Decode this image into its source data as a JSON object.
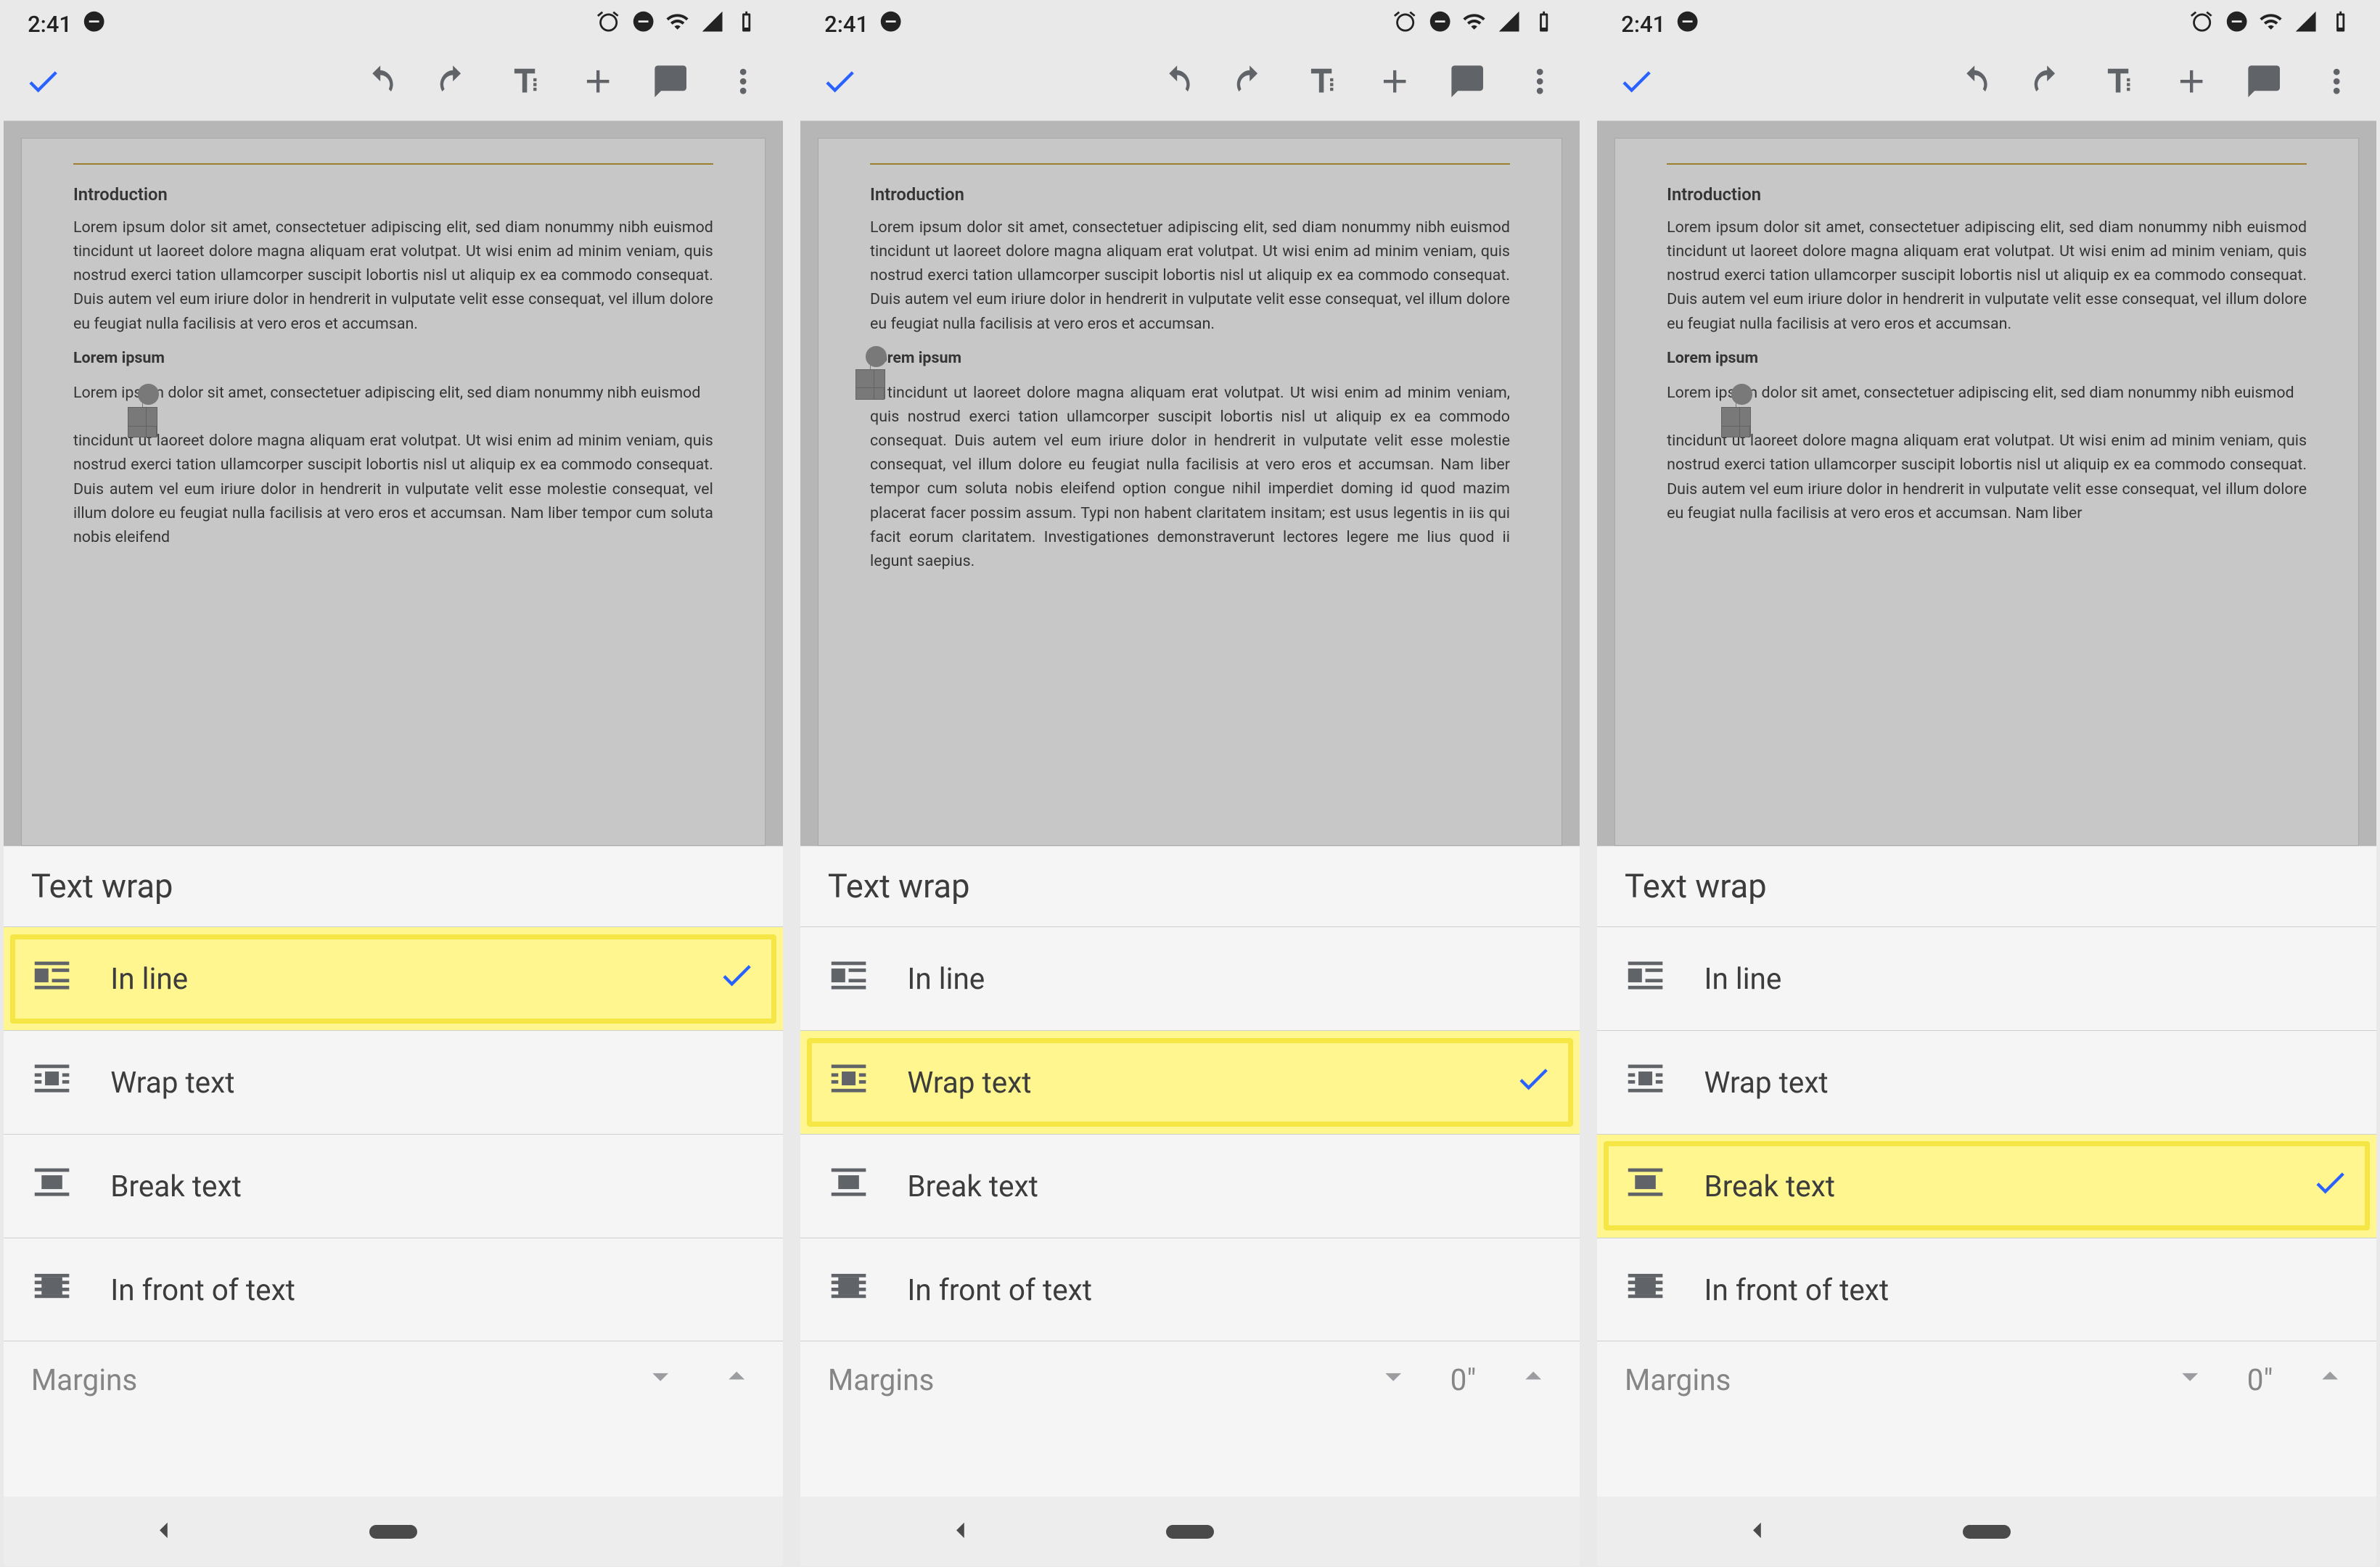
{
  "status": {
    "time": "2:41"
  },
  "toolbar": {
    "done": "Done",
    "undo": "Undo",
    "redo": "Redo",
    "format": "Text format",
    "insert": "Insert",
    "comment": "Comment",
    "more": "More"
  },
  "doc": {
    "heading": "Introduction",
    "para1": "Lorem ipsum dolor sit amet, consectetuer adipiscing elit, sed diam nonummy nibh euismod tincidunt ut laoreet dolore magna aliquam erat volutpat. Ut wisi enim ad minim veniam, quis nostrud exerci tation ullamcorper suscipit lobortis nisl ut aliquip ex ea commodo consequat. Duis autem vel eum iriure dolor in hendrerit in vulputate velit esse consequat, vel illum dolore eu feugiat nulla facilisis at vero eros et accumsan.",
    "subhead": "Lorem ipsum",
    "para2": "Lorem ipsum dolor sit amet, consectetuer adipiscing elit, sed diam nonummy nibh euismod",
    "para3": "tincidunt ut laoreet dolore magna aliquam erat volutpat. Ut wisi enim ad minim veniam, quis nostrud exerci tation ullamcorper suscipit lobortis nisl ut aliquip ex ea commodo consequat. Duis autem vel eum iriure dolor in hendrerit in vulputate velit esse molestie consequat, vel illum dolore eu feugiat nulla facilisis at vero eros et accumsan. Nam liber tempor cum soluta nobis eleifend",
    "wrapPara": "tincidunt ut laoreet dolore magna aliquam erat volutpat. Ut wisi enim ad minim veniam, quis nostrud exerci tation ullamcorper suscipit lobortis nisl ut aliquip ex ea commodo consequat. Duis autem vel eum iriure dolor in hendrerit in vulputate velit esse molestie consequat, vel illum dolore eu feugiat nulla facilisis at vero eros et accumsan. Nam liber tempor cum soluta nobis eleifend option congue nihil imperdiet doming id quod mazim placerat facer possim assum. Typi non habent claritatem insitam; est usus legentis in iis qui facit eorum claritatem. Investigationes demonstraverunt lectores legere me lius quod ii legunt saepius.",
    "breakPara": "tincidunt ut laoreet dolore magna aliquam erat volutpat. Ut wisi enim ad minim veniam, quis nostrud exerci tation ullamcorper suscipit lobortis nisl ut aliquip ex ea commodo consequat. Duis autem vel eum iriure dolor in hendrerit in vulputate velit esse consequat, vel illum dolore eu feugiat nulla facilisis at vero eros et accumsan. Nam liber"
  },
  "sheet": {
    "title": "Text wrap",
    "options": [
      {
        "id": "inline",
        "label": "In line"
      },
      {
        "id": "wrap",
        "label": "Wrap text"
      },
      {
        "id": "break",
        "label": "Break text"
      },
      {
        "id": "front",
        "label": "In front of text"
      }
    ],
    "margins_label": "Margins",
    "margins_value": "0\""
  },
  "panels": [
    {
      "selected": "inline",
      "highlight": "inline",
      "flow": "inline",
      "show_margin_value": false
    },
    {
      "selected": "wrap",
      "highlight": "wrap",
      "flow": "wrap",
      "show_margin_value": true
    },
    {
      "selected": "break",
      "highlight": "break",
      "flow": "inline",
      "show_margin_value": true
    }
  ]
}
